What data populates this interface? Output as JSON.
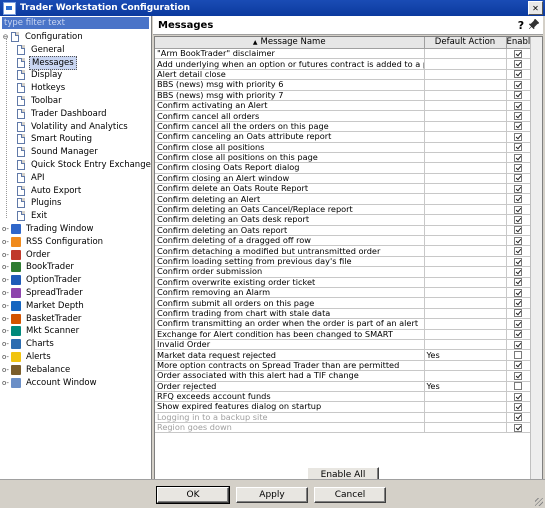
{
  "window": {
    "title": "Trader Workstation Configuration"
  },
  "sidebar": {
    "filter_placeholder": "type filter text",
    "root_label": "Configuration",
    "config_items": [
      "General",
      "Messages",
      "Display",
      "Hotkeys",
      "Toolbar",
      "Trader Dashboard",
      "Volatility and Analytics",
      "Smart Routing",
      "Sound Manager",
      "Quick Stock Entry Exchanges",
      "API",
      "Auto Export",
      "Plugins",
      "Exit"
    ],
    "selected_item": "Messages",
    "app_items": [
      {
        "label": "Trading Window",
        "expander": "o-",
        "icon_color": "#2f66c9"
      },
      {
        "label": "RSS Configuration",
        "expander": "o-",
        "icon_color": "#f08a1c"
      },
      {
        "label": "Order",
        "expander": "o-",
        "icon_color": "#c0392b"
      },
      {
        "label": "BookTrader",
        "expander": "o-",
        "icon_color": "#2e7d32"
      },
      {
        "label": "OptionTrader",
        "expander": "o-",
        "icon_color": "#1e5bb8"
      },
      {
        "label": "SpreadTrader",
        "expander": "o-",
        "icon_color": "#8e44ad"
      },
      {
        "label": "Market Depth",
        "expander": "o-",
        "icon_color": "#1565c0"
      },
      {
        "label": "BasketTrader",
        "expander": "o-",
        "icon_color": "#d35400"
      },
      {
        "label": "Mkt Scanner",
        "expander": "o-",
        "icon_color": "#00897b"
      },
      {
        "label": "Charts",
        "expander": "o-",
        "icon_color": "#2b6cb0"
      },
      {
        "label": "Alerts",
        "expander": "o-",
        "icon_color": "#f1c40f"
      },
      {
        "label": "Rebalance",
        "expander": "o-",
        "icon_color": "#7b5e2b"
      },
      {
        "label": "Account Window",
        "expander": "o-",
        "icon_color": "#6b8fc7"
      }
    ]
  },
  "panel": {
    "title": "Messages",
    "help_icon": "?",
    "pin_icon": "pin-icon"
  },
  "table": {
    "columns": [
      "Message Name",
      "Default Action",
      "Enabled"
    ],
    "rows": [
      {
        "name": "\"Arm BookTrader\" disclaimer",
        "default": "",
        "enabled": true,
        "disabled": false
      },
      {
        "name": "Add underlying when an option or futures contract is added to a page",
        "default": "",
        "enabled": true,
        "disabled": false
      },
      {
        "name": "Alert detail close",
        "default": "",
        "enabled": true,
        "disabled": false
      },
      {
        "name": "BBS (news) msg with priority 6",
        "default": "",
        "enabled": true,
        "disabled": false
      },
      {
        "name": "BBS (news) msg with priority 7",
        "default": "",
        "enabled": true,
        "disabled": false
      },
      {
        "name": "Confirm activating an Alert",
        "default": "",
        "enabled": true,
        "disabled": false
      },
      {
        "name": "Confirm cancel all orders",
        "default": "",
        "enabled": true,
        "disabled": false
      },
      {
        "name": "Confirm cancel all the orders on this page",
        "default": "",
        "enabled": true,
        "disabled": false
      },
      {
        "name": "Confirm canceling an Oats attribute report",
        "default": "",
        "enabled": true,
        "disabled": false
      },
      {
        "name": "Confirm close all positions",
        "default": "",
        "enabled": true,
        "disabled": false
      },
      {
        "name": "Confirm close all positions on this page",
        "default": "",
        "enabled": true,
        "disabled": false
      },
      {
        "name": "Confirm closing Oats Report dialog",
        "default": "",
        "enabled": true,
        "disabled": false
      },
      {
        "name": "Confirm closing an Alert window",
        "default": "",
        "enabled": true,
        "disabled": false
      },
      {
        "name": "Confirm delete an Oats Route Report",
        "default": "",
        "enabled": true,
        "disabled": false
      },
      {
        "name": "Confirm deleting an Alert",
        "default": "",
        "enabled": true,
        "disabled": false
      },
      {
        "name": "Confirm deleting an Oats Cancel/Replace report",
        "default": "",
        "enabled": true,
        "disabled": false
      },
      {
        "name": "Confirm deleting an Oats desk report",
        "default": "",
        "enabled": true,
        "disabled": false
      },
      {
        "name": "Confirm deleting an Oats report",
        "default": "",
        "enabled": true,
        "disabled": false
      },
      {
        "name": "Confirm deleting of a dragged off row",
        "default": "",
        "enabled": true,
        "disabled": false
      },
      {
        "name": "Confirm detaching a modified but untransmitted order",
        "default": "",
        "enabled": true,
        "disabled": false
      },
      {
        "name": "Confirm loading setting from previous day's file",
        "default": "",
        "enabled": true,
        "disabled": false
      },
      {
        "name": "Confirm order submission",
        "default": "",
        "enabled": true,
        "disabled": false
      },
      {
        "name": "Confirm overwrite existing order ticket",
        "default": "",
        "enabled": true,
        "disabled": false
      },
      {
        "name": "Confirm removing an Alarm",
        "default": "",
        "enabled": true,
        "disabled": false
      },
      {
        "name": "Confirm submit all orders on this page",
        "default": "",
        "enabled": true,
        "disabled": false
      },
      {
        "name": "Confirm trading from chart with stale data",
        "default": "",
        "enabled": true,
        "disabled": false
      },
      {
        "name": "Confirm transmitting an order when the order is part of an alert",
        "default": "",
        "enabled": true,
        "disabled": false
      },
      {
        "name": "Exchange for Alert condition has been changed to SMART",
        "default": "",
        "enabled": true,
        "disabled": false
      },
      {
        "name": "Invalid Order",
        "default": "",
        "enabled": true,
        "disabled": false
      },
      {
        "name": "Market data request rejected",
        "default": "Yes",
        "enabled": false,
        "disabled": false
      },
      {
        "name": "More option contracts on Spread Trader than are permitted",
        "default": "",
        "enabled": true,
        "disabled": false
      },
      {
        "name": "Order associated with this alert had a TIF change",
        "default": "",
        "enabled": true,
        "disabled": false
      },
      {
        "name": "Order rejected",
        "default": "Yes",
        "enabled": false,
        "disabled": false
      },
      {
        "name": "RFQ exceeds account funds",
        "default": "",
        "enabled": true,
        "disabled": false
      },
      {
        "name": "Show expired features dialog on startup",
        "default": "",
        "enabled": true,
        "disabled": false
      },
      {
        "name": "Logging in to a backup site",
        "default": "",
        "enabled": true,
        "disabled": true
      },
      {
        "name": "Region goes down",
        "default": "",
        "enabled": true,
        "disabled": true
      }
    ]
  },
  "buttons": {
    "enable_all": "Enable All",
    "ok": "OK",
    "apply": "Apply",
    "cancel": "Cancel"
  }
}
